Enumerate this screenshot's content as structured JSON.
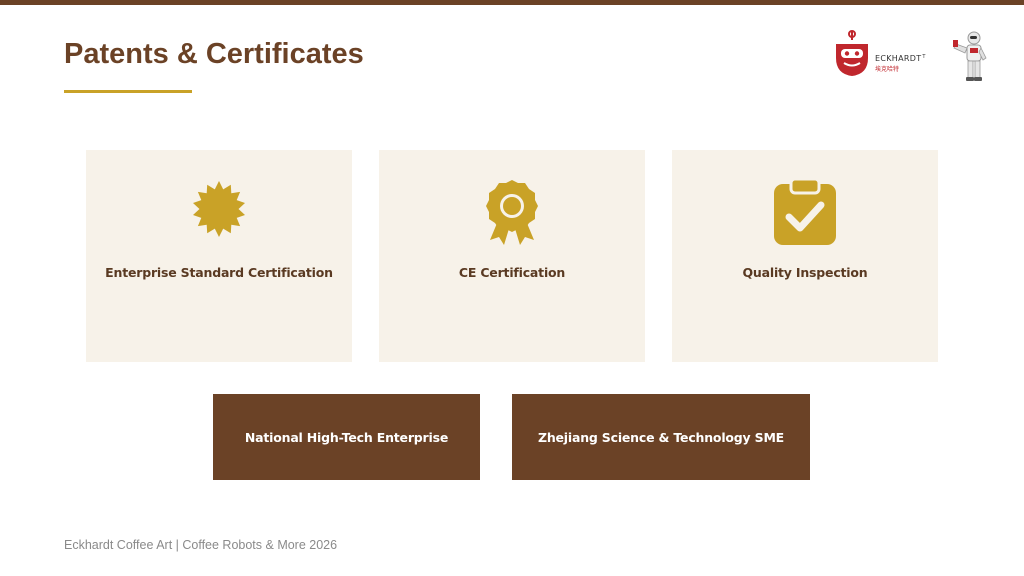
{
  "slide": {
    "title": "Patents & Certificates",
    "footer": "Eckhardt Coffee Art | Coffee Robots & More 2026"
  },
  "logo": {
    "brand": "ECKHARDT",
    "brand_suffix": "T",
    "sub": "埃克哈特"
  },
  "cards": [
    {
      "label": "Enterprise Standard Certification",
      "icon": "seal-badge-icon"
    },
    {
      "label": "CE Certification",
      "icon": "award-ribbon-icon"
    },
    {
      "label": "Quality Inspection",
      "icon": "clipboard-check-icon"
    }
  ],
  "dark_boxes": [
    {
      "label": "National High-Tech Enterprise"
    },
    {
      "label": "Zhejiang Science & Technology SME"
    }
  ],
  "colors": {
    "brown": "#6b4226",
    "gold": "#c9a227",
    "card_bg": "#f7f2e9",
    "logo_red": "#c0272d"
  }
}
